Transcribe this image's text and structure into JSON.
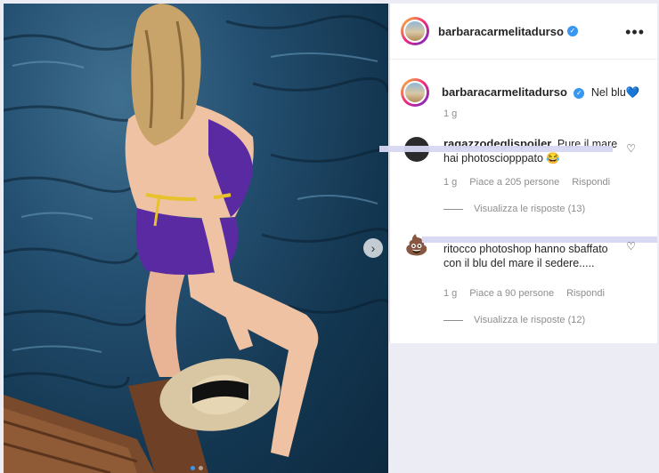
{
  "post": {
    "username": "barbaracarmelitadurso",
    "caption_user": "barbaracarmelitadurso",
    "caption_text": "Nel blu💙",
    "caption_time": "1 g"
  },
  "comments": [
    {
      "username": "ragazzodeglispoiler",
      "text": "Pure il mare hai photosciopppato 😂",
      "time": "1 g",
      "likes": "Piace a 205 persone",
      "reply": "Rispondi",
      "view_replies": "Visualizza le risposte (13)"
    },
    {
      "text": "ritocco photoshop hanno sbaffato con il blu del mare il sedere.....",
      "time": "1 g",
      "likes": "Piace a 90 persone",
      "reply": "Rispondi",
      "view_replies": "Visualizza le risposte (12)",
      "avatar_emoji": "💩"
    }
  ],
  "icons": {
    "more": "•••",
    "heart": "♡",
    "next": "›",
    "verified": "✓"
  },
  "colors": {
    "accent": "#3897f0",
    "strike": "#d7d7f3"
  }
}
